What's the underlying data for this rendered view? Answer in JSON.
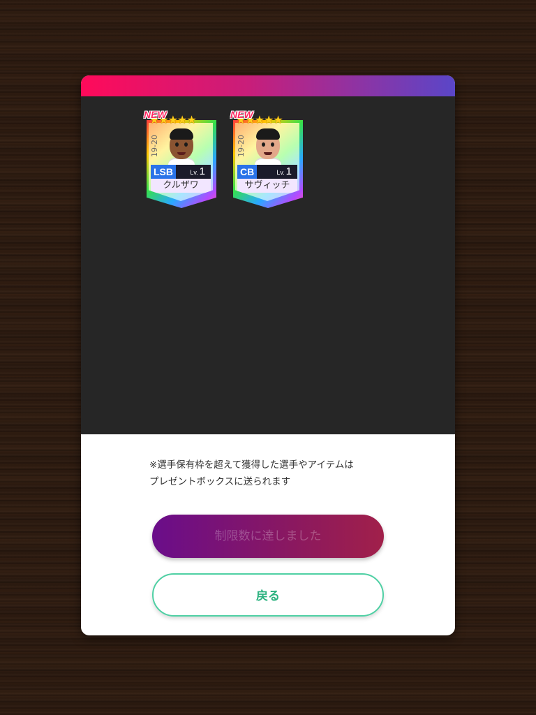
{
  "cards": [
    {
      "badge": "NEW",
      "stars": "★★★★★",
      "season": "19-20",
      "position": "LSB",
      "level_label": "Lv.",
      "level": "1",
      "name": "クルザワ",
      "skin_color": "#8a5432"
    },
    {
      "badge": "NEW",
      "stars": "★★★★★",
      "season": "19-20",
      "position": "CB",
      "level_label": "Lv.",
      "level": "1",
      "name": "サヴィッチ",
      "skin_color": "#e3a88a"
    }
  ],
  "notice": {
    "line1": "※選手保有枠を超えて獲得した選手やアイテムは",
    "line2": "プレゼントボックスに送られます"
  },
  "buttons": {
    "limit_label": "制限数に達しました",
    "back_label": "戻る"
  },
  "colors": {
    "header_gradient_start": "#ff0a5a",
    "header_gradient_end": "#5a46c8",
    "back_button_accent": "#2bb27f"
  }
}
